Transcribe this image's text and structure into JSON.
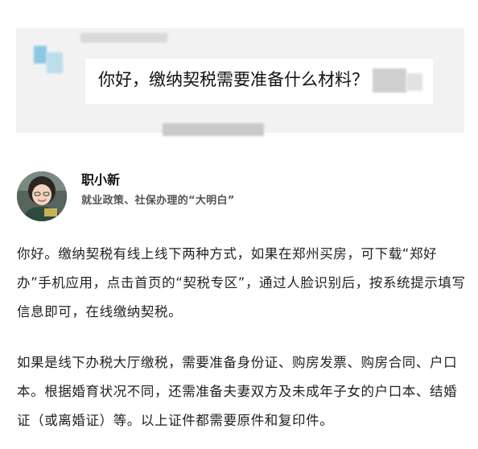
{
  "question": {
    "text": "你好，缴纳契税需要准备什么材料？"
  },
  "expert": {
    "name": "职小新",
    "title": "就业政策、社保办理的“大明白”"
  },
  "answer": {
    "paragraphs": [
      "你好。缴纳契税有线上线下两种方式，如果在郑州买房，可下载“郑好办”手机应用，点击首页的“契税专区”，通过人脸识别后，按系统提示填写信息即可，在线缴纳契税。",
      "如果是线下办税大厅缴税，需要准备身份证、购房发票、购房合同、户口本。根据婚育状况不同，还需准备夫妻双方及未成年子女的户口本、结婚证（或离婚证）等。以上证件都需要原件和复印件。"
    ]
  },
  "colors": {
    "card_background": "#f2f2f2",
    "bubble_background": "#ffffff",
    "text": "#222222",
    "subtitle": "#555555"
  }
}
